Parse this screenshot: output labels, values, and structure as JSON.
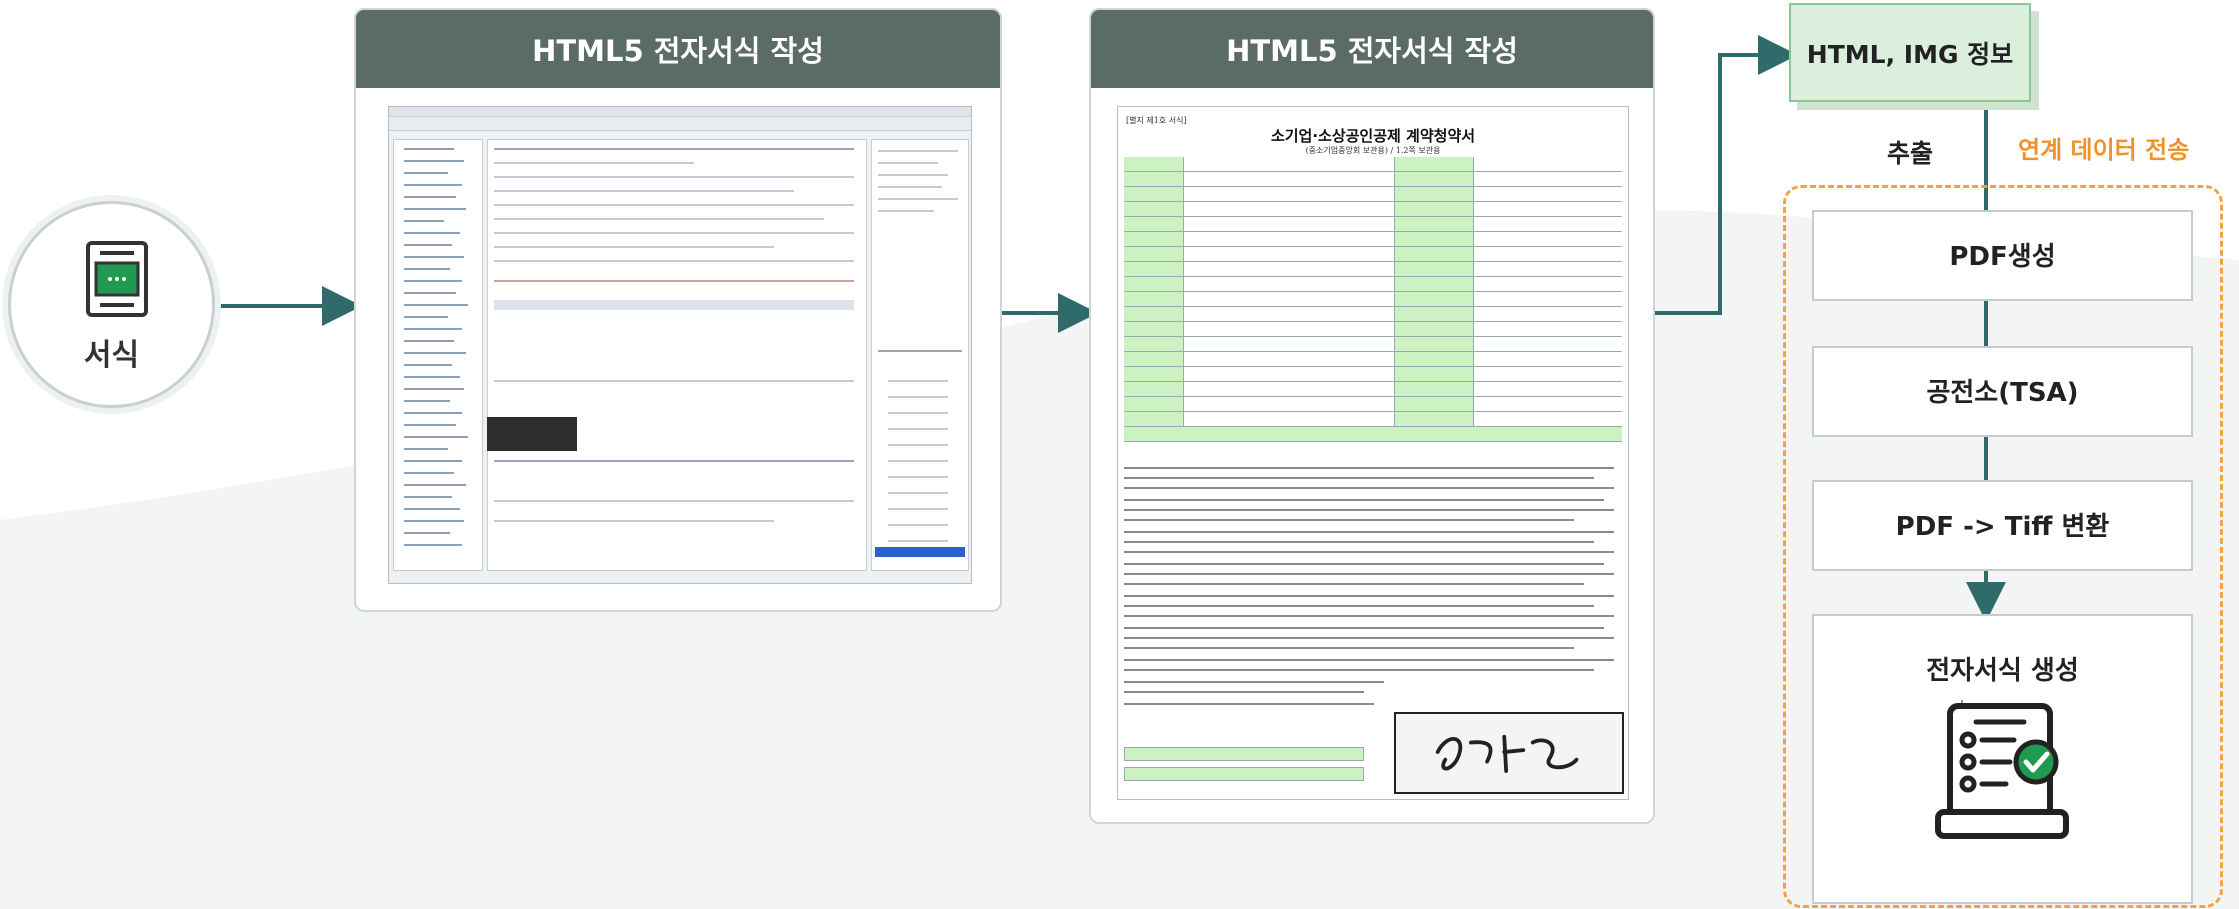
{
  "start": {
    "label": "서식",
    "icon": "form-document-icon"
  },
  "panels": [
    {
      "title": "HTML5 전자서식 작성"
    },
    {
      "title": "HTML5 전자서식 작성"
    }
  ],
  "form_preview": {
    "tag": "[별지 제1호 서식]",
    "title": "소기업·소상공인공제 계약청약서",
    "subtitle": "(중소기업중앙회 보관용) / 1.2쪽 보관용"
  },
  "pipeline": {
    "extract": "HTML, IMG 정보 추출",
    "transfer_label": "연계 데이터 전송",
    "steps": [
      "PDF생성",
      "공전소(TSA)",
      "PDF -> Tiff 변환",
      "전자서식 생성"
    ]
  },
  "colors": {
    "header": "#5b6b66",
    "arrow": "#2f6b6b",
    "extract_fill": "#dcefdc",
    "dashed": "#f2a245",
    "form_green": "#ccf2c4"
  }
}
